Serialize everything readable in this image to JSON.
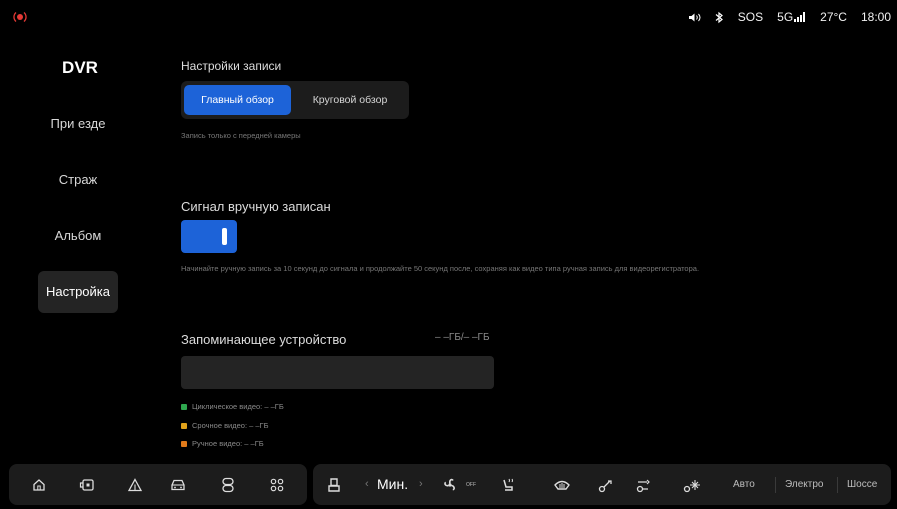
{
  "status": {
    "sos": "SOS",
    "network": "5G",
    "temperature": "27°C",
    "time": "18:00"
  },
  "sidebar": {
    "title": "DVR",
    "items": [
      {
        "label": "При езде"
      },
      {
        "label": "Страж"
      },
      {
        "label": "Альбом"
      },
      {
        "label": "Настройка"
      }
    ]
  },
  "recording": {
    "title": "Настройки записи",
    "options": [
      "Главный обзор",
      "Круговой обзор"
    ],
    "selected": "Главный обзор",
    "hint": "Запись только с передней камеры"
  },
  "manual": {
    "title": "Сигнал вручную записан",
    "enabled": true,
    "hint": "Начинайте ручную запись за 10 секунд до сигнала и продолжайте 50 секунд после, сохраняя как видео типа ручная запись для видеорегистратора."
  },
  "storage": {
    "title": "Запоминающее устройство",
    "value": "– –ГБ/– –ГБ",
    "legend": [
      {
        "label": "Циклическое видео: – –ГБ",
        "color": "#2fa84f"
      },
      {
        "label": "Срочное видео: – –ГБ",
        "color": "#e0a21a"
      },
      {
        "label": "Ручное видео: – –ГБ",
        "color": "#e07a1a"
      }
    ]
  },
  "dock": {
    "left_icons": [
      "home-icon",
      "dashcam-icon",
      "navigation-icon",
      "car-icon",
      "media-icon",
      "apps-icon"
    ],
    "fan_level": "Мин.",
    "fan_state": "OFF",
    "modes": [
      "Авто",
      "Электро",
      "Шоссе"
    ]
  },
  "colors": {
    "accent": "#1d63d8",
    "status_alert": "#e53935"
  }
}
